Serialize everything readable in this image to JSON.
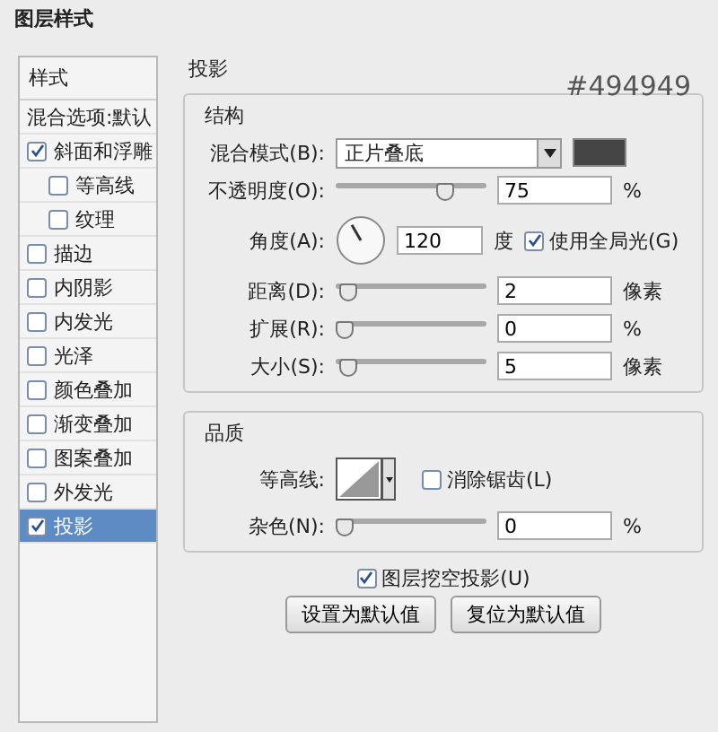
{
  "window": {
    "title": "图层样式"
  },
  "sidebar": {
    "header": "样式",
    "blend_options": "混合选项:默认",
    "items": [
      {
        "label": "斜面和浮雕",
        "checked": true,
        "selected": false,
        "children": [
          {
            "label": "等高线",
            "checked": false,
            "selected": false
          },
          {
            "label": "纹理",
            "checked": false,
            "selected": false
          }
        ]
      },
      {
        "label": "描边",
        "checked": false,
        "selected": false
      },
      {
        "label": "内阴影",
        "checked": false,
        "selected": false
      },
      {
        "label": "内发光",
        "checked": false,
        "selected": false
      },
      {
        "label": "光泽",
        "checked": false,
        "selected": false
      },
      {
        "label": "颜色叠加",
        "checked": false,
        "selected": false
      },
      {
        "label": "渐变叠加",
        "checked": false,
        "selected": false
      },
      {
        "label": "图案叠加",
        "checked": false,
        "selected": false
      },
      {
        "label": "外发光",
        "checked": false,
        "selected": false
      },
      {
        "label": "投影",
        "checked": true,
        "selected": true
      }
    ]
  },
  "panel": {
    "title": "投影",
    "structure": {
      "title": "结构",
      "color_note": "#494949",
      "blend_mode": {
        "label": "混合模式(B):",
        "value": "正片叠底"
      },
      "opacity": {
        "label": "不透明度(O):",
        "level": 0.75,
        "value": "75",
        "unit": "%"
      },
      "angle": {
        "label": "角度(A):",
        "value": "120",
        "unit": "度",
        "global_light": {
          "label": "使用全局光(G)",
          "checked": true
        }
      },
      "sliders": [
        {
          "label": "距离(D):",
          "level": 0.03,
          "value": "2",
          "unit": "像素"
        },
        {
          "label": "扩展(R):",
          "level": 0,
          "value": "0",
          "unit": "%"
        },
        {
          "label": "大小(S):",
          "level": 0.03,
          "value": "5",
          "unit": "像素"
        }
      ]
    },
    "quality": {
      "title": "品质",
      "contour_label": "等高线:",
      "anti_alias": {
        "label": "消除锯齿(L)",
        "checked": false
      },
      "noise": {
        "label": "杂色(N):",
        "level": 0,
        "value": "0",
        "unit": "%"
      }
    },
    "knockout": {
      "label": "图层挖空投影(U)",
      "checked": true
    },
    "buttons": [
      "设置为默认值",
      "复位为默认值"
    ]
  }
}
